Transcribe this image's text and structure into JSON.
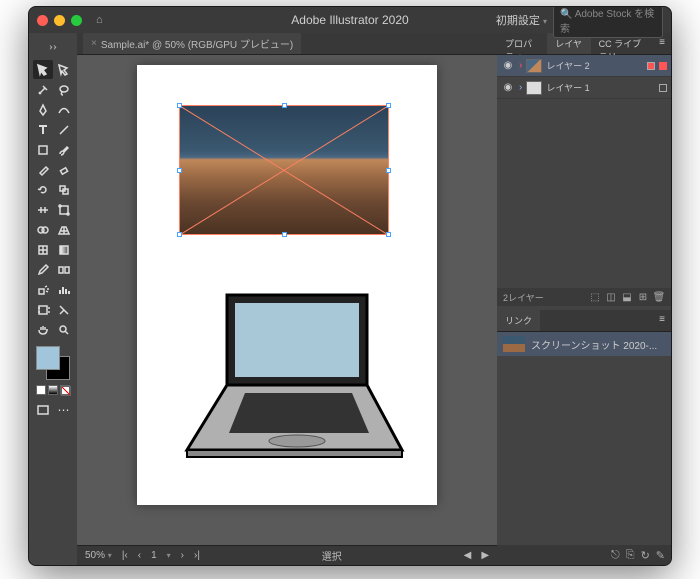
{
  "titlebar": {
    "app_title": "Adobe Illustrator 2020",
    "preset_label": "初期設定",
    "search_placeholder": "Adobe Stock を検索"
  },
  "document": {
    "tab_label": "Sample.ai* @ 50% (RGB/GPU プレビュー)",
    "close": "×"
  },
  "panels": {
    "tabs": {
      "properties": "プロパティ",
      "layers": "レイヤー",
      "cc": "CC ライブラリ"
    },
    "layers": [
      {
        "name": "レイヤー 2"
      },
      {
        "name": "レイヤー 1"
      }
    ],
    "layer_count": "2レイヤー",
    "links_tab": "リンク",
    "link_item": "スクリーンショット 2020-..."
  },
  "status": {
    "zoom": "50%",
    "artboard_nav": "1",
    "tool_label": "選択"
  },
  "icons": {
    "home": "⌂",
    "caret": "▾",
    "arrow_l": "‹",
    "arrow_r": "›",
    "search": "🔍",
    "eye": "◉",
    "chevron": "›",
    "menu": "≡",
    "trash": "🗑",
    "new": "⊞",
    "link": "⎘"
  }
}
